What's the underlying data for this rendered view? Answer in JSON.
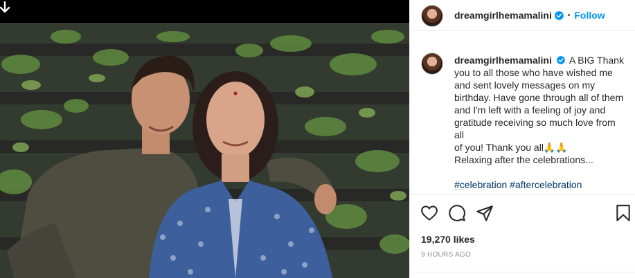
{
  "post": {
    "username": "dreamgirlhemamalini",
    "follow_label": "Follow",
    "separator": "•",
    "caption_lines": [
      "A BIG Thank",
      "you to all those who have wished me",
      "and sent lovely messages on my",
      "birthday. Have gone through all of them",
      "and I'm left with a feeling of joy and",
      "gratitude receiving so much love from all",
      "of you! Thank you all🙏🙏",
      "Relaxing after the celebrations..."
    ],
    "hashtags": [
      "#celebration",
      "#aftercelebration"
    ],
    "likes": "19,270 likes",
    "timestamp": "9 HOURS AGO"
  },
  "icons": {
    "download": "arrow-down-icon",
    "verified": "verified-badge-icon",
    "like": "heart-icon",
    "comment": "comment-bubble-icon",
    "share": "paper-plane-icon",
    "save": "bookmark-icon"
  },
  "colors": {
    "link_blue": "#0095f6",
    "hashtag": "#00376b",
    "muted": "#8e8e8e",
    "text": "#262626"
  }
}
